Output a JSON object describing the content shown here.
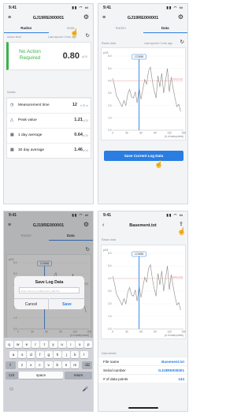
{
  "colors": {
    "accent": "#2a7de1",
    "green": "#3bb34a",
    "threshold": "#e07a7a"
  },
  "status_bar": {
    "time": "9:41"
  },
  "screen1": {
    "title": "GJ19RE000001",
    "tabs": [
      "Radon",
      "Data"
    ],
    "action_label": "Action level",
    "last_synced": "Last synced: 0 min ago",
    "status_text": "No Action Required",
    "value": "0.80",
    "unit": "pCi/l",
    "details_label": "Details",
    "details": [
      {
        "icon": "clock-icon",
        "label": "Measurement time",
        "value": "12",
        "unit": "h  32  m"
      },
      {
        "icon": "triangle-icon",
        "label": "Peak value",
        "value": "1.21",
        "unit": "pCi/l"
      },
      {
        "icon": "calendar-icon",
        "label": "1 day average",
        "value": "0.64",
        "unit": "pCi/l"
      },
      {
        "icon": "calendar-icon",
        "label": "30 day average",
        "value": "1.46",
        "unit": "pCi/l"
      }
    ]
  },
  "screen2": {
    "title": "GJ19RE000001",
    "tabs": [
      "Radon",
      "Data"
    ],
    "radon_data_label": "Radon data",
    "last_synced": "Last synced: 0 min ago",
    "button": "Save Current Log Data"
  },
  "screen3": {
    "title": "GJ19RE000001",
    "tabs": [
      "Radon",
      "Data"
    ],
    "dialog": {
      "title": "Save Log Data",
      "placeholder": "Enter name (e.g. Basement_Mar 01)",
      "cancel": "Cancel",
      "save": "Save"
    },
    "keyboard": {
      "row1": [
        "q",
        "w",
        "e",
        "r",
        "t",
        "y",
        "u",
        "i",
        "o",
        "p"
      ],
      "row2": [
        "a",
        "s",
        "d",
        "f",
        "g",
        "h",
        "j",
        "k",
        "l"
      ],
      "row3": [
        "z",
        "x",
        "c",
        "v",
        "b",
        "n",
        "m"
      ],
      "shift": "⇧",
      "delete": "⌫",
      "numbers": "123",
      "space": "space",
      "return": "return",
      "emoji": "☺",
      "mic": "🎤"
    }
  },
  "screen4": {
    "title": "Basement.txt",
    "radon_data_label": "Radon data",
    "details_label": "Data details",
    "rows": [
      {
        "label": "File name",
        "value": "Basement.txt"
      },
      {
        "label": "Serial number",
        "value": "GJ19RE000001"
      },
      {
        "label": "# of data points",
        "value": "144"
      }
    ]
  },
  "chart_data": {
    "type": "line",
    "ylabel": "pCi/l",
    "xlabel": "(# of data points)",
    "ylim": [
      0,
      6
    ],
    "xlim": [
      0,
      150
    ],
    "yticks": [
      "0.0",
      "1.0",
      "2.0",
      "3.0",
      "4.0",
      "5.0",
      "6.0"
    ],
    "xticks": [
      "0",
      "30",
      "60",
      "90",
      "120",
      "150"
    ],
    "threshold": {
      "value": 4.0,
      "label": "Action level"
    },
    "cursor": {
      "x": 56,
      "label": "123456"
    },
    "series": [
      {
        "x": [
          0,
          4,
          8,
          12,
          16,
          20,
          24,
          28,
          32,
          36,
          40,
          44,
          48,
          52,
          56,
          60,
          64,
          68,
          72,
          76,
          80,
          84,
          88,
          92,
          96,
          100,
          104,
          108,
          112,
          116,
          120,
          124,
          128,
          132,
          136,
          140,
          144
        ],
        "values": [
          4.2,
          3.6,
          2.8,
          2.5,
          2.2,
          1.9,
          2.4,
          2.0,
          2.9,
          3.3,
          2.7,
          2.6,
          3.1,
          2.2,
          3.4,
          2.5,
          3.3,
          4.1,
          3.7,
          4.8,
          5.1,
          4.0,
          3.2,
          2.6,
          4.4,
          3.5,
          4.6,
          3.0,
          4.0,
          5.0,
          3.1,
          4.3,
          3.4,
          2.6,
          1.9,
          2.1,
          1.5
        ]
      }
    ]
  }
}
